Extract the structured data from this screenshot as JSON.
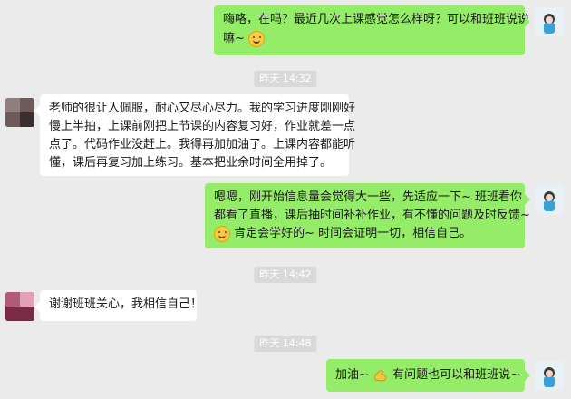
{
  "chat": {
    "messages": [
      {
        "side": "right",
        "text1": "嗨咯，在吗？最近几次上课感觉怎么样呀？可以和班班说说",
        "text2": "嘛~ ",
        "emoji": "smile-emoji"
      },
      {
        "type": "timestamp",
        "text": "昨天 14:32"
      },
      {
        "side": "left",
        "lines": [
          "老师的很让人佩服，耐心又尽心尽力。我的学习进度刚刚好",
          "慢上半拍，上课前刚把上节课的内容复习好，作业就差一点",
          "点了。代码作业没赶上。我得再加加油了。上课内容都能听",
          "懂，课后再复习加上练习。基本把业余时间全用掉了。"
        ]
      },
      {
        "side": "right",
        "lines": [
          "嗯嗯，刚开始信息量会觉得大一些，先适应一下~ 班班看你",
          "都看了直播，课后抽时间补补作业，有不懂的问题及时反馈~"
        ],
        "line3_after_emoji": " 肯定会学好的~ 时间会证明一切，相信自己。",
        "emoji": "smile-emoji"
      },
      {
        "type": "timestamp",
        "text": "昨天 14:42"
      },
      {
        "side": "left",
        "text": "谢谢班班关心，我相信自己！"
      },
      {
        "type": "timestamp",
        "text": "昨天 14:48"
      },
      {
        "side": "right",
        "text_before": "加油~ ",
        "text_after": " 有问题也可以和班班说~",
        "emoji": "muscle-emoji"
      }
    ]
  }
}
